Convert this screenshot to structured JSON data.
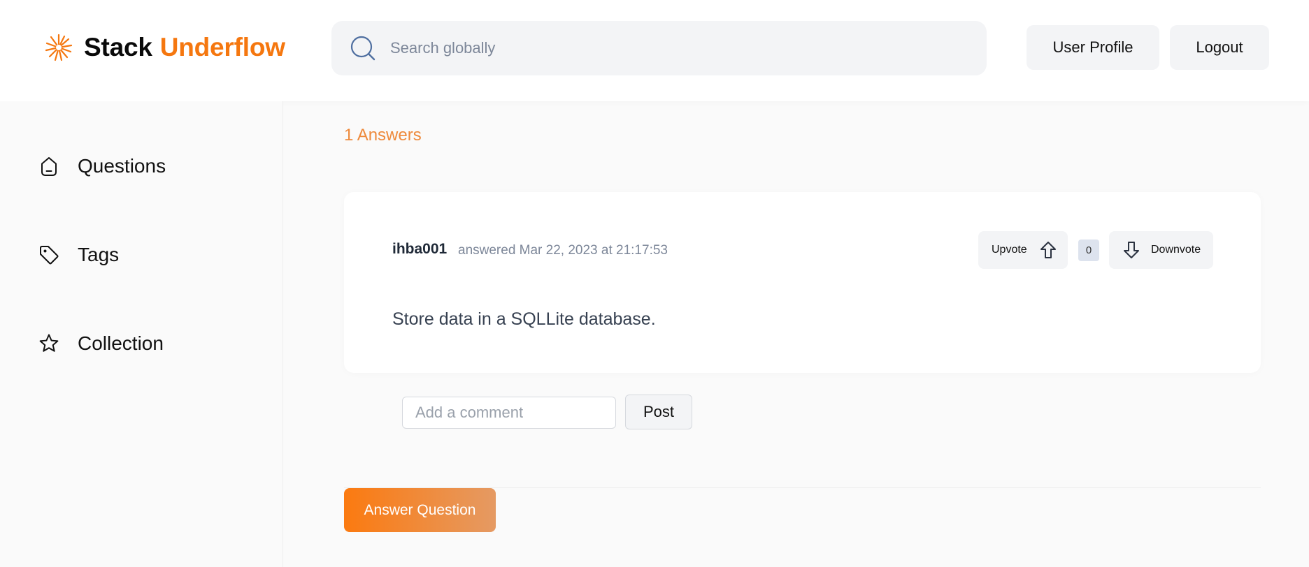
{
  "brand": {
    "name_part1": "Stack",
    "name_part2": "Underflow"
  },
  "header": {
    "search_placeholder": "Search globally",
    "profile_label": "User Profile",
    "logout_label": "Logout"
  },
  "sidebar": {
    "items": [
      {
        "label": "Questions",
        "icon": "home-icon"
      },
      {
        "label": "Tags",
        "icon": "tag-icon"
      },
      {
        "label": "Collection",
        "icon": "star-icon"
      }
    ]
  },
  "main": {
    "answers_count": "1 Answers",
    "answers": [
      {
        "author": "ihba001",
        "meta": "answered Mar 22, 2023 at 21:17:53",
        "upvote_label": "Upvote",
        "votes": "0",
        "downvote_label": "Downvote",
        "body": "Store data in a SQLLite database."
      }
    ],
    "comment_placeholder": "Add a comment",
    "post_label": "Post",
    "answer_button_label": "Answer Question"
  },
  "colors": {
    "accent": "#f5770f",
    "answers_count": "#ee8a3c",
    "background": "#fafafa",
    "surface": "#ffffff",
    "button_bg": "#f3f4f6"
  }
}
